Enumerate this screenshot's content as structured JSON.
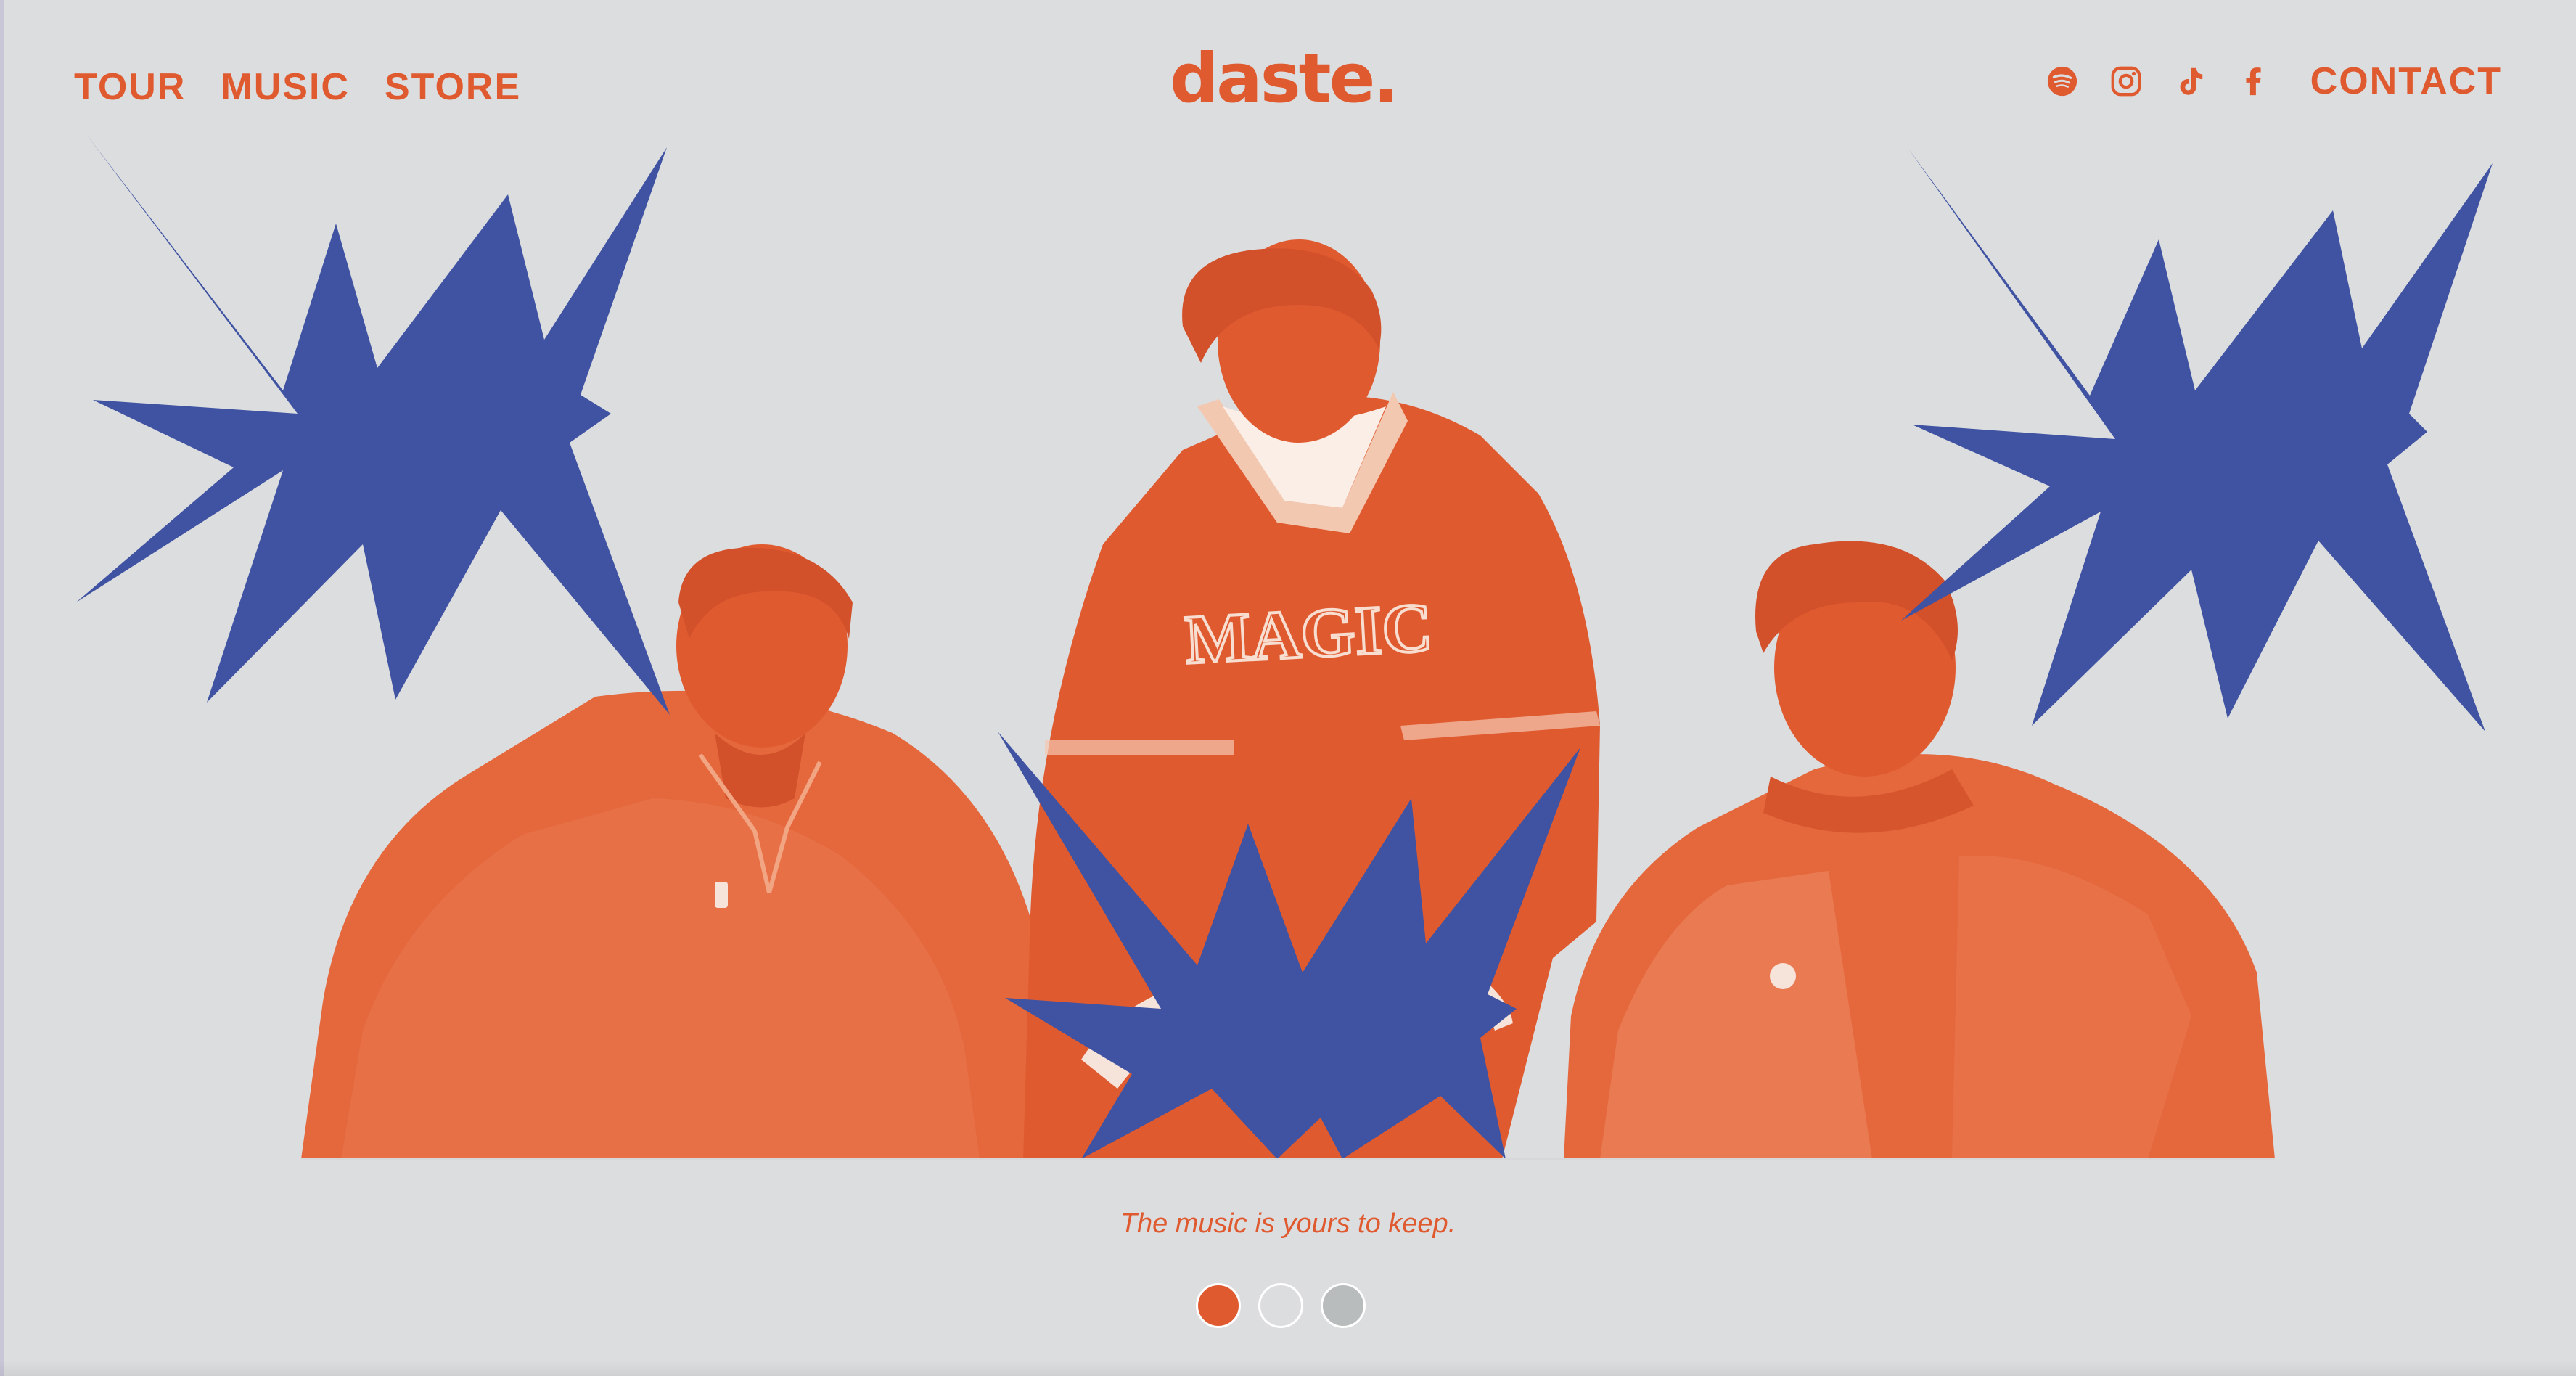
{
  "header": {
    "nav_left": [
      {
        "label": "TOUR"
      },
      {
        "label": "MUSIC"
      },
      {
        "label": "STORE"
      }
    ],
    "logo_text": "daste.",
    "social_icons": [
      "spotify-icon",
      "instagram-icon",
      "tiktok-icon",
      "facebook-icon"
    ],
    "contact_label": "CONTACT"
  },
  "hero": {
    "image_alt": "Three band members in orange duotone with blue starburst shapes",
    "jersey_text": "MAGIC"
  },
  "tagline": "The music is yours to keep.",
  "carousel": {
    "dots": [
      {
        "color": "#e05a30",
        "active": true
      },
      {
        "color": "#dcdddf",
        "active": false
      },
      {
        "color": "#b8bcbc",
        "active": false
      }
    ]
  },
  "colors": {
    "background": "#dcdddf",
    "accent_orange": "#e05a30",
    "accent_blue": "#3f53a2"
  }
}
